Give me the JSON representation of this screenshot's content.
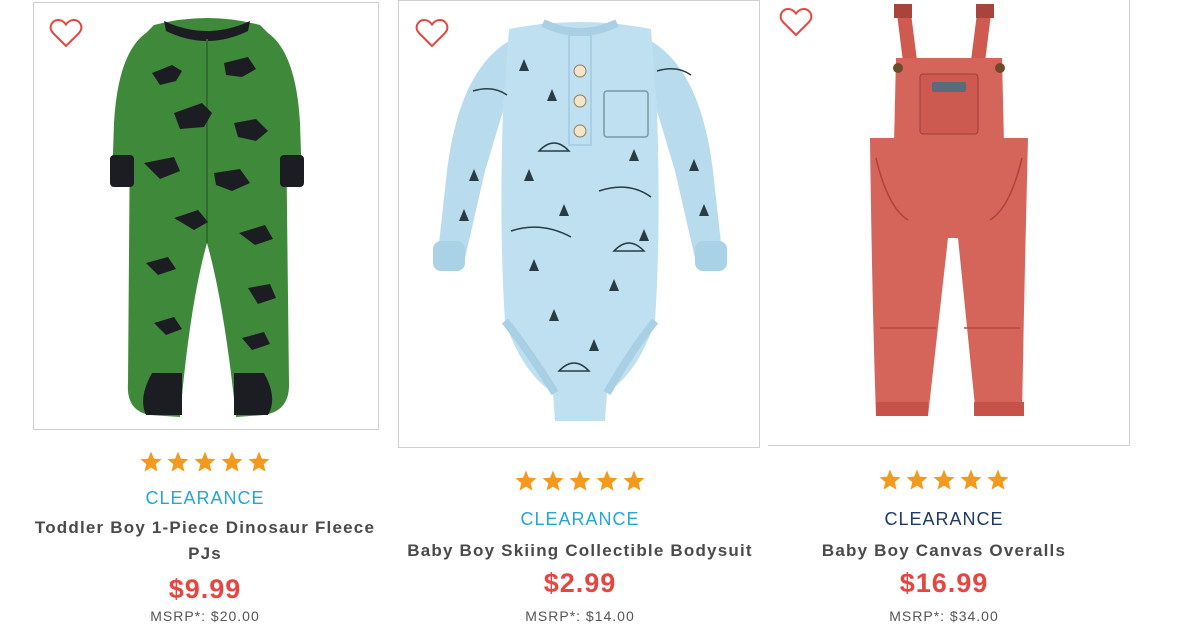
{
  "colors": {
    "star": "#f39a1e",
    "clearance_light": "#23a6d8",
    "clearance_dark": "#1f3a63",
    "price": "#e5463f",
    "heart": "#e5463f"
  },
  "products": [
    {
      "name": "Toddler Boy 1-Piece Dinosaur Fleece PJs",
      "badge": "CLEARANCE",
      "price": "$9.99",
      "msrp": "MSRP*: $20.00",
      "rating": 5,
      "favorite_icon": "heart-outline-icon"
    },
    {
      "name": "Baby Boy Skiing Collectible Bodysuit",
      "badge": "CLEARANCE",
      "price": "$2.99",
      "msrp": "MSRP*: $14.00",
      "rating": 5,
      "favorite_icon": "heart-outline-icon"
    },
    {
      "name": "Baby Boy Canvas Overalls",
      "badge": "CLEARANCE",
      "price": "$16.99",
      "msrp": "MSRP*: $34.00",
      "rating": 5,
      "favorite_icon": "heart-outline-icon"
    }
  ]
}
